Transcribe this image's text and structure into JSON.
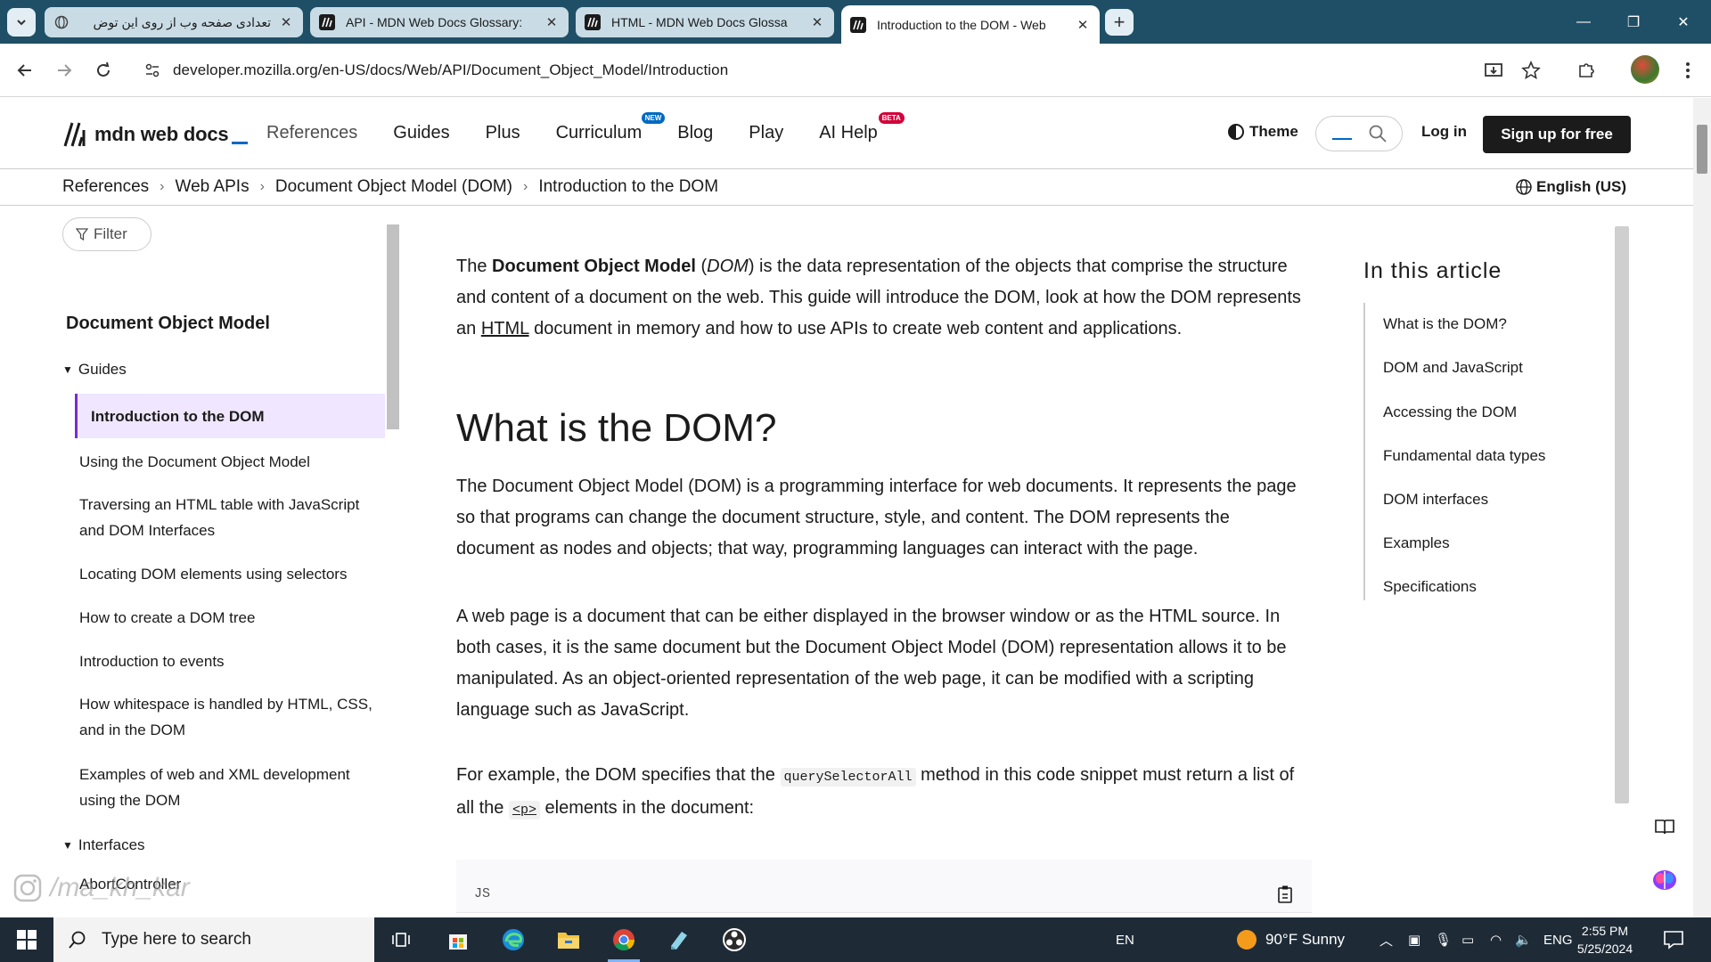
{
  "browser": {
    "tabs": [
      {
        "title": "تعدادی صفحه وب از روی این توض",
        "active": false
      },
      {
        "title": "API - MDN Web Docs Glossary:",
        "active": false
      },
      {
        "title": "HTML - MDN Web Docs Glossa",
        "active": false
      },
      {
        "title": "Introduction to the DOM - Web",
        "active": true
      }
    ],
    "url": "developer.mozilla.org/en-US/docs/Web/API/Document_Object_Model/Introduction"
  },
  "header": {
    "logo_text": "mdn web docs",
    "nav": [
      {
        "label": "References",
        "badge": ""
      },
      {
        "label": "Guides",
        "badge": ""
      },
      {
        "label": "Plus",
        "badge": ""
      },
      {
        "label": "Curriculum",
        "badge": "NEW"
      },
      {
        "label": "Blog",
        "badge": ""
      },
      {
        "label": "Play",
        "badge": ""
      },
      {
        "label": "AI Help",
        "badge": "BETA"
      }
    ],
    "theme_label": "Theme",
    "login_label": "Log in",
    "signup_label": "Sign up for free"
  },
  "breadcrumbs": [
    "References",
    "Web APIs",
    "Document Object Model (DOM)",
    "Introduction to the DOM"
  ],
  "language": "English (US)",
  "sidebar": {
    "filter_label": "Filter",
    "title": "Document Object Model",
    "guides_label": "Guides",
    "items": [
      {
        "label": "Introduction to the DOM",
        "active": true
      },
      {
        "label": "Using the Document Object Model"
      },
      {
        "label": "Traversing an HTML table with JavaScript and DOM Interfaces"
      },
      {
        "label": "Locating DOM elements using selectors"
      },
      {
        "label": "How to create a DOM tree"
      },
      {
        "label": "Introduction to events"
      },
      {
        "label": "How whitespace is handled by HTML, CSS, and in the DOM"
      },
      {
        "label": "Examples of web and XML development using the DOM"
      }
    ],
    "interfaces_label": "Interfaces",
    "interfaces_first": "AbortController"
  },
  "article": {
    "intro": {
      "prefix": "The ",
      "bold": "Document Object Model",
      "mid1": " (",
      "italic": "DOM",
      "mid2": ") is the data representation of the objects that comprise the structure and content of a document on the web. This guide will introduce the DOM, look at how the DOM represents an ",
      "link": "HTML",
      "suffix": " document in memory and how to use APIs to create web content and applications."
    },
    "h2": "What is the DOM?",
    "p1": "The Document Object Model (DOM) is a programming interface for web documents. It represents the page so that programs can change the document structure, style, and content. The DOM represents the document as nodes and objects; that way, programming languages can interact with the page.",
    "p2": "A web page is a document that can be either displayed in the browser window or as the HTML source. In both cases, it is the same document but the Document Object Model (DOM) representation allows it to be manipulated. As an object-oriented representation of the web page, it can be modified with a scripting language such as JavaScript.",
    "p3": {
      "prefix": "For example, the DOM specifies that the ",
      "code1": "querySelectorAll",
      "mid": " method in this code snippet must return a list of all the ",
      "code2": "<p>",
      "suffix": " elements in the document:"
    },
    "code_lang": "JS"
  },
  "toc": {
    "title": "In this article",
    "items": [
      "What is the DOM?",
      "DOM and JavaScript",
      "Accessing the DOM",
      "Fundamental data types",
      "DOM interfaces",
      "Examples",
      "Specifications"
    ]
  },
  "watermark": "/ma_kh_kar",
  "taskbar": {
    "search_placeholder": "Type here to search",
    "lang_short": "EN",
    "weather": "90°F  Sunny",
    "ime": "ENG",
    "time": "2:55 PM",
    "date": "5/25/2024"
  }
}
